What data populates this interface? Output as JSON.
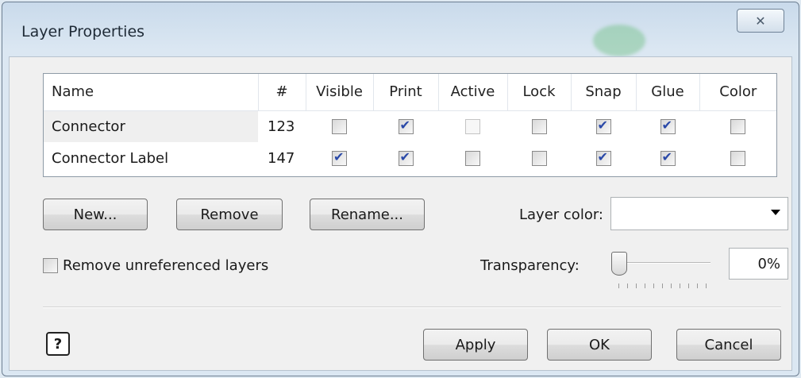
{
  "window": {
    "title": "Layer Properties",
    "close_label": "✕"
  },
  "table": {
    "headers": [
      "Name",
      "#",
      "Visible",
      "Print",
      "Active",
      "Lock",
      "Snap",
      "Glue",
      "Color"
    ],
    "rows": [
      {
        "name": "Connector",
        "count": "123",
        "visible": false,
        "print": true,
        "active": false,
        "lock": false,
        "snap": true,
        "glue": true,
        "color": false
      },
      {
        "name": "Connector Label",
        "count": "147",
        "visible": true,
        "print": true,
        "active": false,
        "lock": false,
        "snap": true,
        "glue": true,
        "color": false
      }
    ]
  },
  "buttons": {
    "new": "New...",
    "remove": "Remove",
    "rename": "Rename...",
    "apply": "Apply",
    "ok": "OK",
    "cancel": "Cancel"
  },
  "layer_color": {
    "label": "Layer color:",
    "value": ""
  },
  "remove_unreferenced": {
    "label": "Remove unreferenced layers",
    "checked": false
  },
  "transparency": {
    "label": "Transparency:",
    "value": "0%",
    "level": 0
  },
  "help_icon": "help-icon",
  "colors": {
    "check": "#2a49a8",
    "window_bg": "#dbe7f2",
    "client_bg": "#f0f0f0"
  }
}
